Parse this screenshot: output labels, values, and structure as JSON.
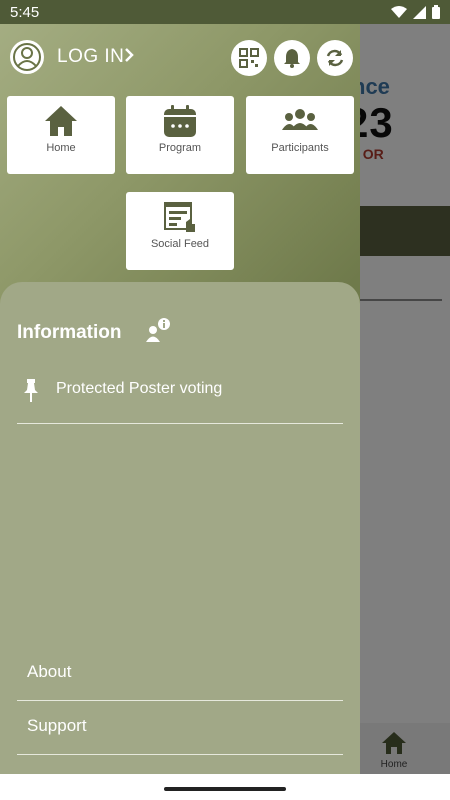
{
  "status_bar": {
    "time": "5:45"
  },
  "background_app": {
    "conference_fragment": "nce",
    "year_fragment": "23",
    "location_fragment": ", OR",
    "bottom_nav_home_label": "Home"
  },
  "drawer": {
    "header": {
      "login_label": "LOG IN"
    },
    "tiles": [
      {
        "label": "Home",
        "icon": "home-icon"
      },
      {
        "label": "Program",
        "icon": "calendar-icon"
      },
      {
        "label": "Participants",
        "icon": "participants-icon"
      },
      {
        "label": "Social Feed",
        "icon": "social-feed-icon"
      }
    ],
    "information": {
      "title": "Information",
      "items": [
        {
          "label": "Protected Poster voting",
          "icon": "pin-icon"
        }
      ]
    },
    "footer": [
      {
        "label": "About"
      },
      {
        "label": "Support"
      }
    ]
  },
  "colors": {
    "accent_olive": "#5a6140",
    "drawer_panel": "#a1a887",
    "status_bar": "#4f5a37"
  }
}
